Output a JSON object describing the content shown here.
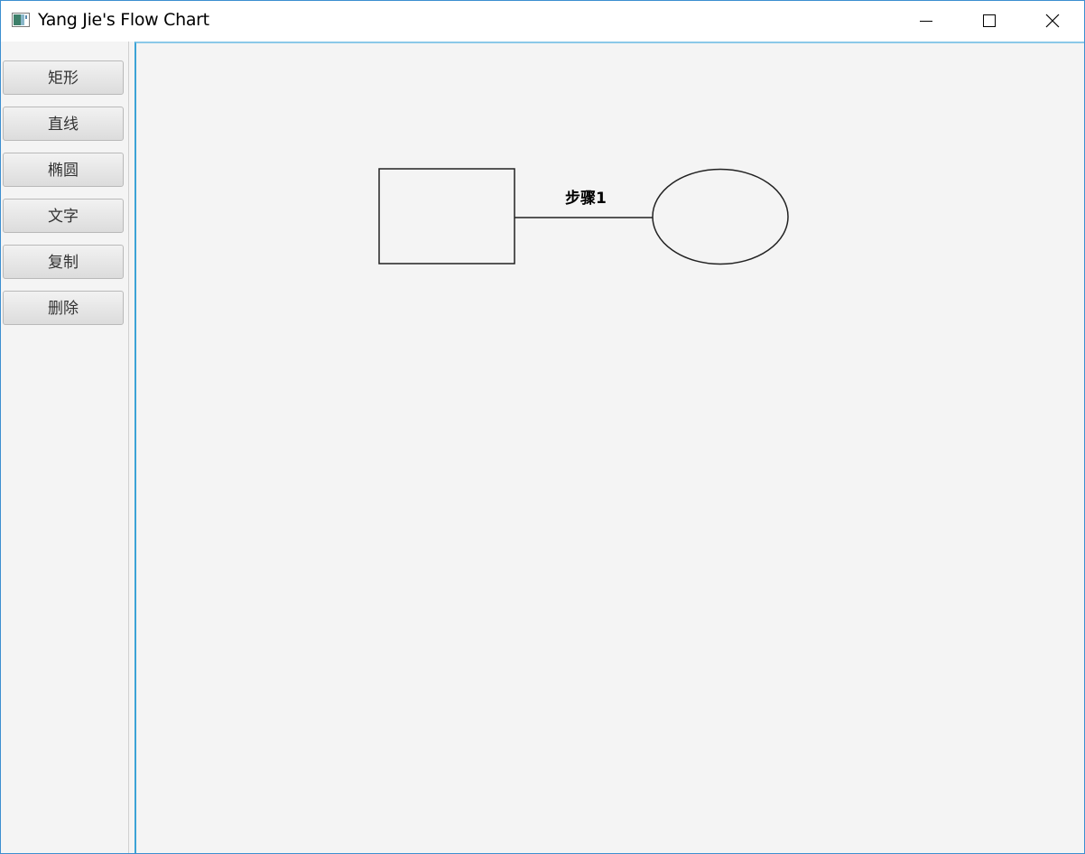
{
  "window": {
    "title": "Yang Jie's Flow Chart"
  },
  "titlebar_icons": {
    "app": "app-icon",
    "minimize": "minimize-icon",
    "maximize": "maximize-icon",
    "close": "close-icon"
  },
  "toolbar": {
    "rect_label": "矩形",
    "line_label": "直线",
    "ellipse_label": "椭圆",
    "text_label": "文字",
    "copy_label": "复制",
    "delete_label": "删除"
  },
  "canvas": {
    "connector_label": "步骤1"
  },
  "colors": {
    "accent": "#3ba3d6",
    "canvas_bg": "#f4f4f4",
    "stroke": "#222222"
  }
}
